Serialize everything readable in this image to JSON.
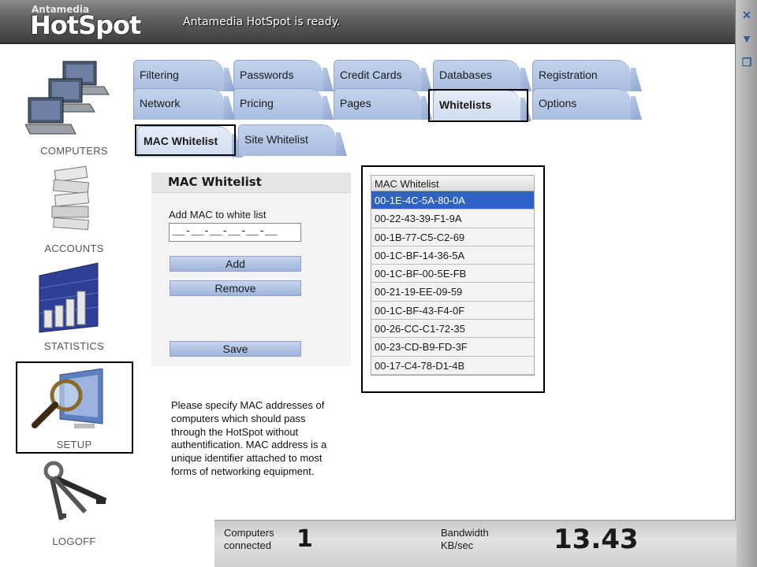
{
  "app": {
    "brand_small": "Antamedia",
    "brand_big": "HotSpot",
    "status": "Antamedia HotSpot is ready."
  },
  "nav": {
    "computers": "COMPUTERS",
    "accounts": "ACCOUNTS",
    "statistics": "STATISTICS",
    "setup": "SETUP",
    "logoff": "LOGOFF"
  },
  "tabs_row1": [
    "Filtering",
    "Passwords",
    "Credit Cards",
    "Databases",
    "Registration"
  ],
  "tabs_row2": [
    "Network",
    "Pricing",
    "Pages",
    "Whitelists",
    "Options"
  ],
  "subtabs": [
    "MAC Whitelist",
    "Site Whitelist"
  ],
  "form": {
    "header": "MAC Whitelist",
    "add_label": "Add MAC to white list",
    "mac_value": "__-__-__-__-__-__",
    "add_button": "Add",
    "remove_button": "Remove",
    "save_button": "Save"
  },
  "help_text": "Please specify MAC addresses of computers which should pass through the HotSpot without authentification. MAC address is a unique identifier attached to most forms of networking equipment.",
  "whitelist": {
    "header": "MAC Whitelist",
    "items": [
      "00-1E-4C-5A-80-0A",
      "00-22-43-39-F1-9A",
      "00-1B-77-C5-C2-69",
      "00-1C-BF-14-36-5A",
      "00-1C-BF-00-5E-FB",
      "00-21-19-EE-09-59",
      "00-1C-BF-43-F4-0F",
      "00-26-CC-C1-72-35",
      "00-23-CD-B9-FD-3F",
      "00-17-C4-78-D1-4B"
    ],
    "selected_index": 0
  },
  "status_bar": {
    "computers_label": "Computers connected",
    "computers_value": "1",
    "bandwidth_label": "Bandwidth KB/sec",
    "bandwidth_value": "13.43"
  },
  "colors": {
    "tab": "#b3c5e6",
    "selection": "#2f62c8"
  }
}
